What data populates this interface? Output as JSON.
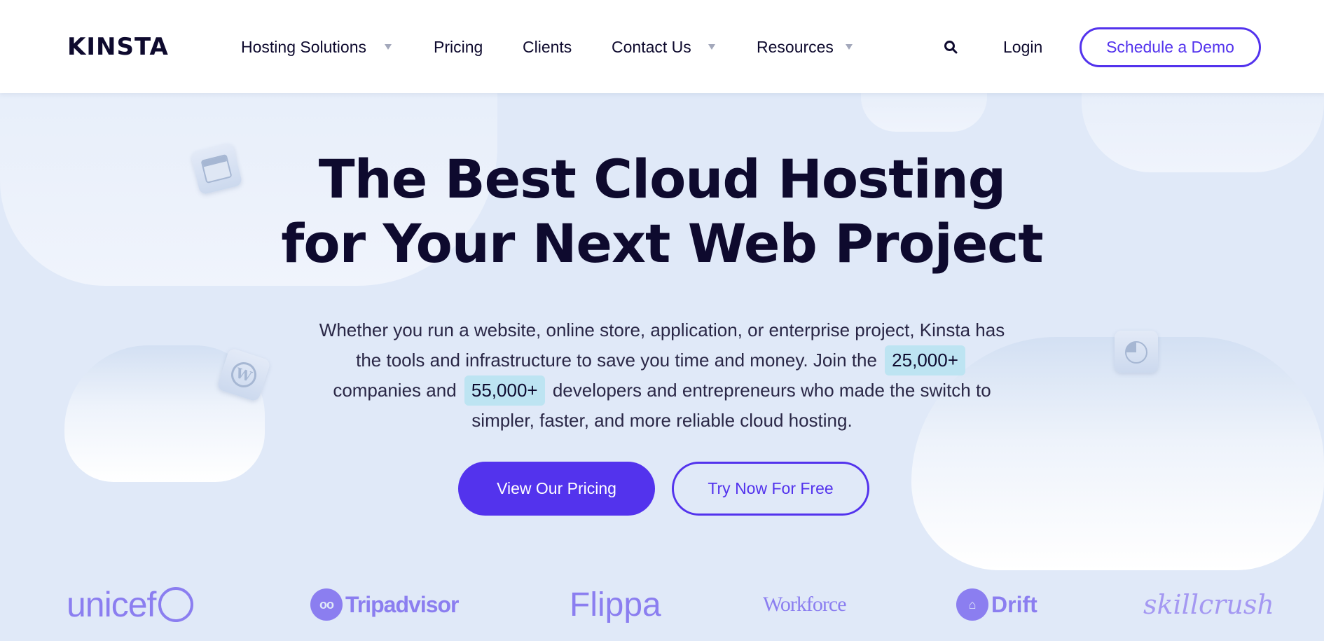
{
  "header": {
    "logo": "KINSTA",
    "nav": [
      {
        "label": "Hosting Solutions",
        "has_dropdown": true
      },
      {
        "label": "Pricing",
        "has_dropdown": false
      },
      {
        "label": "Clients",
        "has_dropdown": false
      },
      {
        "label": "Contact Us",
        "has_dropdown": true
      },
      {
        "label": "Resources",
        "has_dropdown": true
      }
    ],
    "search_icon": "search-icon",
    "login": "Login",
    "demo_button": "Schedule a Demo"
  },
  "hero": {
    "title_line1": "The Best Cloud Hosting",
    "title_line2": "for Your Next Web Project",
    "text_part1": "Whether you run a website, online store, application, or enterprise project, Kinsta has the tools and infrastructure to save you time and money. Join the",
    "badge_companies": "25,000+",
    "text_part2": "companies and",
    "badge_developers": "55,000+",
    "text_part3": "developers and entrepreneurs who made the switch to simpler, faster, and more reliable cloud hosting.",
    "primary_button": "View Our Pricing",
    "secondary_button": "Try Now For Free"
  },
  "clients": [
    {
      "name": "unicef"
    },
    {
      "name": "Tripadvisor"
    },
    {
      "name": "Flippa"
    },
    {
      "name": "Workforce"
    },
    {
      "name": "Drift"
    },
    {
      "name": "skillcrush"
    }
  ],
  "colors": {
    "accent": "#5333ed",
    "background": "#e0e9f8",
    "badge": "#bde4f2",
    "logo_tint": "#8b7ef0",
    "text_dark": "#0e0a2e"
  }
}
